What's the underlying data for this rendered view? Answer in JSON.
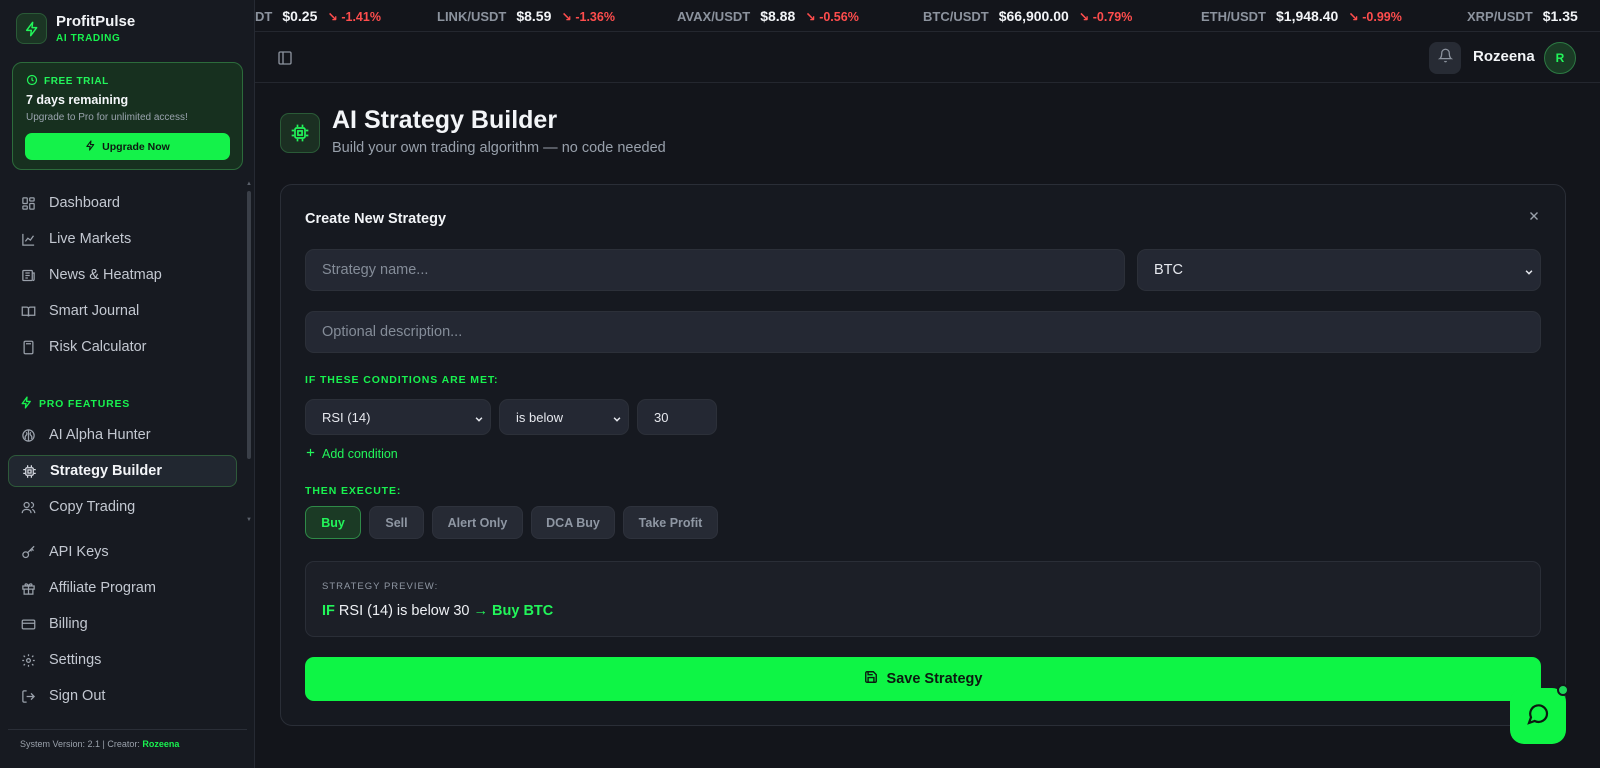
{
  "brand": {
    "name": "ProfitPulse",
    "sub": "AI TRADING"
  },
  "trial": {
    "badge": "FREE TRIAL",
    "title": "7 days remaining",
    "text": "Upgrade to Pro for unlimited access!",
    "button": "Upgrade Now"
  },
  "nav": {
    "main": [
      {
        "label": "Dashboard",
        "icon": "dashboard-icon"
      },
      {
        "label": "Live Markets",
        "icon": "chart-line-icon"
      },
      {
        "label": "News & Heatmap",
        "icon": "newspaper-icon"
      },
      {
        "label": "Smart Journal",
        "icon": "book-icon"
      },
      {
        "label": "Risk Calculator",
        "icon": "calculator-icon"
      }
    ],
    "pro_label": "PRO FEATURES",
    "pro": [
      {
        "label": "AI Alpha Hunter",
        "icon": "brain-icon"
      },
      {
        "label": "Strategy Builder",
        "icon": "chip-icon",
        "active": true
      },
      {
        "label": "Copy Trading",
        "icon": "users-icon"
      }
    ],
    "account": [
      {
        "label": "API Keys",
        "icon": "key-icon"
      },
      {
        "label": "Affiliate Program",
        "icon": "gift-icon"
      },
      {
        "label": "Billing",
        "icon": "credit-card-icon"
      },
      {
        "label": "Settings",
        "icon": "gear-icon"
      },
      {
        "label": "Sign Out",
        "icon": "logout-icon"
      }
    ]
  },
  "footer": {
    "text": "System Version: 2.1 | Creator:",
    "creator": "Rozeena"
  },
  "ticker": [
    {
      "sym": "DT",
      "price": "$0.25",
      "chg": "↘ -1.41%"
    },
    {
      "sym": "LINK/USDT",
      "price": "$8.59",
      "chg": "↘ -1.36%"
    },
    {
      "sym": "AVAX/USDT",
      "price": "$8.88",
      "chg": "↘ -0.56%"
    },
    {
      "sym": "BTC/USDT",
      "price": "$66,900.00",
      "chg": "↘ -0.79%"
    },
    {
      "sym": "ETH/USDT",
      "price": "$1,948.40",
      "chg": "↘ -0.99%"
    },
    {
      "sym": "XRP/USDT",
      "price": "$1.35",
      "chg": ""
    }
  ],
  "header": {
    "username": "Rozeena",
    "avatar_initial": "R"
  },
  "page": {
    "title": "AI Strategy Builder",
    "subtitle": "Build your own trading algorithm — no code needed"
  },
  "card": {
    "title": "Create New Strategy",
    "name_placeholder": "Strategy name...",
    "asset": "BTC",
    "desc_placeholder": "Optional description...",
    "conditions_label": "IF THESE CONDITIONS ARE MET:",
    "indicator": "RSI (14)",
    "operator": "is below",
    "value": "30",
    "add_condition": "Add condition",
    "execute_label": "THEN EXECUTE:",
    "actions": [
      "Buy",
      "Sell",
      "Alert Only",
      "DCA Buy",
      "Take Profit"
    ],
    "active_action": "Buy",
    "preview_label": "STRATEGY PREVIEW:",
    "preview": {
      "if": "IF",
      "condition": "RSI (14) is below 30",
      "then": "→ Buy BTC"
    },
    "save": "Save Strategy"
  },
  "colors": {
    "accent": "#14f24a",
    "negative": "#ff4d4d",
    "background": "#13151b"
  }
}
